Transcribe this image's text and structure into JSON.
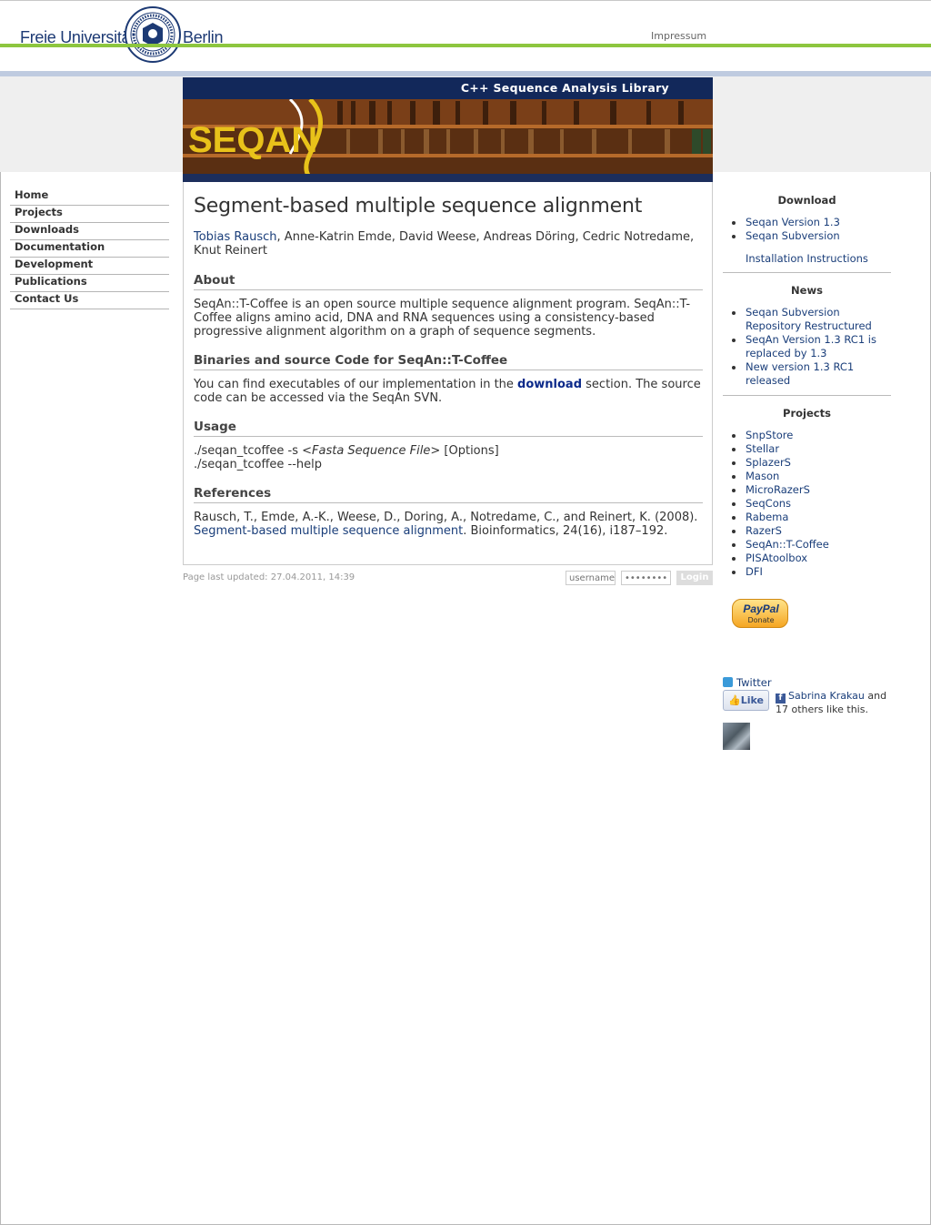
{
  "header": {
    "university_left": "Freie Universität",
    "university_right": "Berlin",
    "impressum": "Impressum"
  },
  "banner": {
    "tagline": "C++ Sequence Analysis Library",
    "logo_text": "SEQAN"
  },
  "leftnav": {
    "items": [
      {
        "label": "Home"
      },
      {
        "label": "Projects"
      },
      {
        "label": "Downloads"
      },
      {
        "label": "Documentation"
      },
      {
        "label": "Development"
      },
      {
        "label": "Publications"
      },
      {
        "label": "Contact Us"
      }
    ]
  },
  "main": {
    "title": "Segment-based multiple sequence alignment",
    "authors_link": "Tobias Rausch",
    "authors_rest": ", Anne-Katrin Emde, David Weese, Andreas Döring, Cedric Notredame, Knut Reinert",
    "about_heading": "About",
    "about_text": "SeqAn::T-Coffee is an open source multiple sequence alignment program. SeqAn::T-Coffee aligns amino acid, DNA and RNA sequences using a consistency-based progressive alignment algorithm on a graph of sequence segments.",
    "binaries_heading": "Binaries and source Code for SeqAn::T-Coffee",
    "binaries_pre": "You can find executables of our implementation in the ",
    "binaries_link": "download",
    "binaries_post": " section. The source code can be accessed via the SeqAn SVN.",
    "usage_heading": "Usage",
    "usage_line1_pre": "./seqan_tcoffee -s ",
    "usage_line1_em": "<Fasta Sequence File>",
    "usage_line1_post": " [Options]",
    "usage_line2": "./seqan_tcoffee --help",
    "references_heading": "References",
    "ref_pre": "Rausch, T., Emde, A.-K., Weese, D., Doring, A., Notredame, C., and Reinert, K. (2008). ",
    "ref_link": "Segment-based multiple sequence alignment",
    "ref_post": ". Bioinformatics, 24(16), i187–192."
  },
  "footer": {
    "updated": "Page last updated: 27.04.2011, 14:39",
    "username_placeholder": "username",
    "password_placeholder": "••••••••",
    "login_label": "Login"
  },
  "sidebar": {
    "download": {
      "heading": "Download",
      "items": [
        "Seqan Version 1.3",
        "Seqan Subversion"
      ],
      "extra": "Installation Instructions"
    },
    "news": {
      "heading": "News",
      "items": [
        "Seqan Subversion Repository Restructured",
        "SeqAn Version 1.3 RC1 is replaced by 1.3",
        "New version 1.3 RC1 released"
      ]
    },
    "projects": {
      "heading": "Projects",
      "items": [
        "SnpStore",
        "Stellar",
        "SplazerS",
        "Mason",
        "MicroRazerS",
        "SeqCons",
        "Rabema",
        "RazerS",
        "SeqAn::T-Coffee",
        "PISAtoolbox",
        "DFI"
      ]
    },
    "paypal_label": "PayPal",
    "paypal_donate": "Donate",
    "twitter": "Twitter",
    "fb_like": "Like",
    "fb_name": "Sabrina Krakau",
    "fb_rest": " and 17 others like this."
  }
}
